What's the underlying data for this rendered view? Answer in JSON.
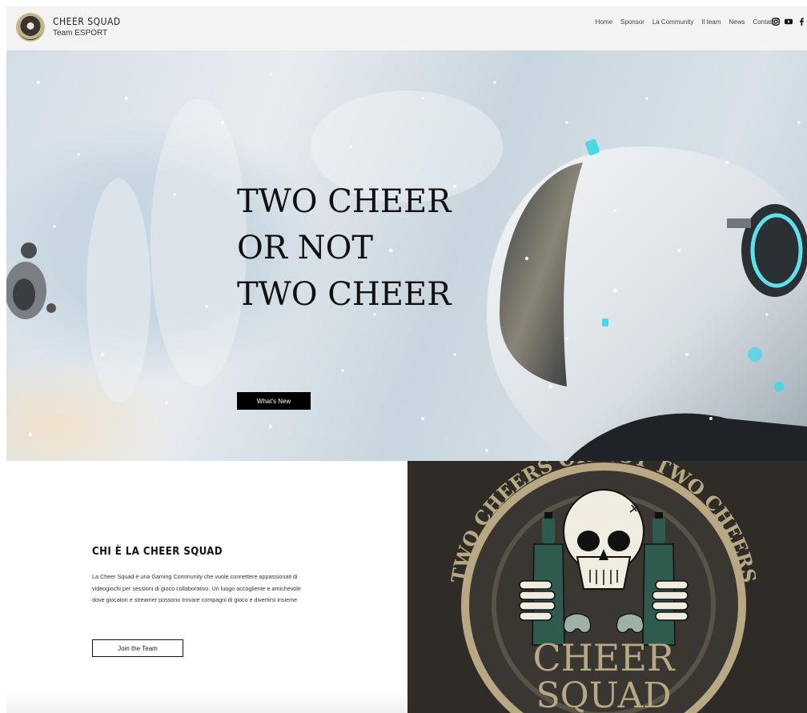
{
  "header": {
    "brand_name": "CHEER SQUAD",
    "brand_sub": "Team ESPORT",
    "nav": [
      "Home",
      "Sponsor",
      "La Community",
      "Il team",
      "News",
      "Contatti"
    ],
    "socials": [
      "instagram-icon",
      "youtube-icon",
      "facebook-icon"
    ]
  },
  "hero": {
    "title": "TWO CHEER\nOR NOT\nTWO CHEER",
    "button_label": "What's New"
  },
  "about": {
    "title": "CHI È LA CHEER SQUAD",
    "text": "La Cheer Squad è una Gaming Community che vuole connettere appassionati di videogiochi per sessioni di gioco collaborativo. Un luogo accogliente e amichevole dove giocatori e streamer possono trovare compagni di gioco e divertirsi insieme",
    "button_label": "Join the Team"
  },
  "badge": {
    "ring_text": "TWO CHEERS OR NOT TWO CHEERS",
    "word1": "CHEER",
    "word2": "SQUAD"
  },
  "colors": {
    "header_bg": "#f3f3f3",
    "badge_bg": "#2f2c28",
    "badge_tan": "#b8a884",
    "bottle": "#2f5a4e"
  }
}
